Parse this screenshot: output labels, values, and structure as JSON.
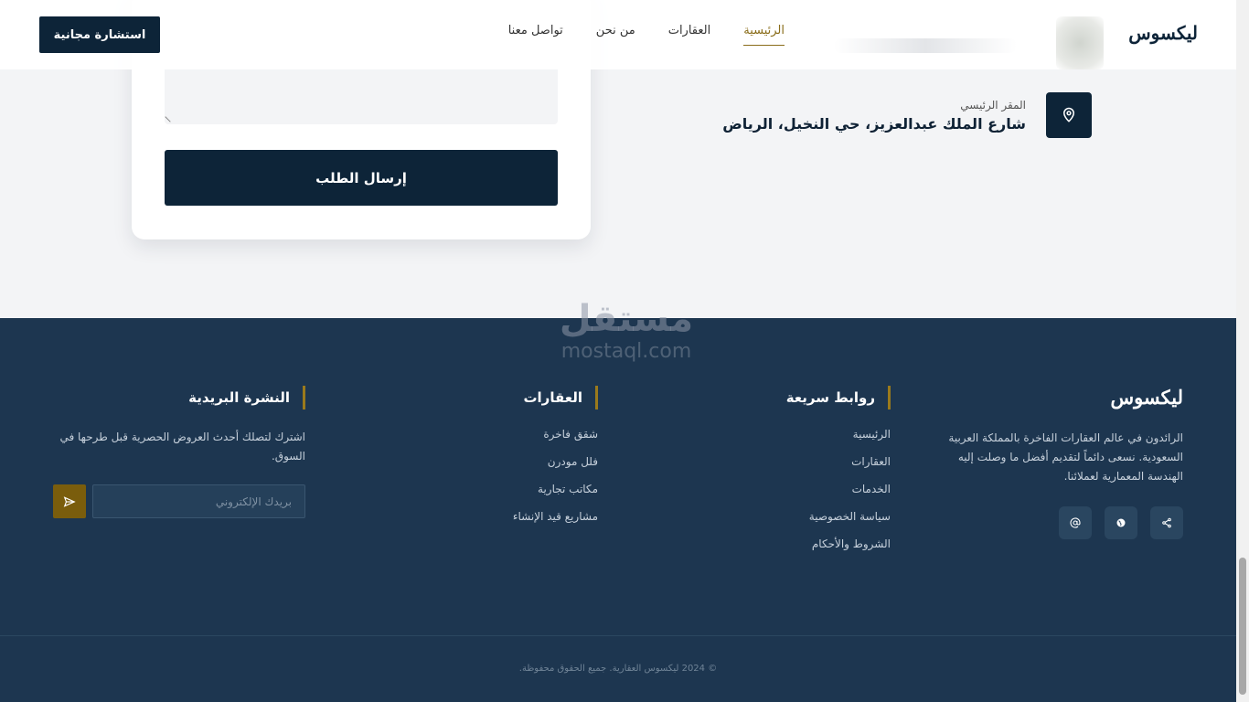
{
  "header": {
    "logo": "ليكسوس",
    "nav": [
      {
        "label": "الرئيسية",
        "active": true
      },
      {
        "label": "العقارات",
        "active": false
      },
      {
        "label": "من نحن",
        "active": false
      },
      {
        "label": "تواصل معنا",
        "active": false
      }
    ],
    "cta_label": "استشارة مجانية"
  },
  "contact": {
    "address_label": "المقر الرئيسي",
    "address_value": "شارع الملك عبدالعزيز، حي النخيل، الرياض",
    "submit_label": "إرسال الطلب"
  },
  "footer": {
    "brand": {
      "name": "ليكسوس",
      "description": "الرائدون في عالم العقارات الفاخرة بالمملكة العربية السعودية. نسعى دائماً لتقديم أفضل ما وصلت إليه الهندسة المعمارية لعملائنا."
    },
    "quick_links": {
      "title": "روابط سريعة",
      "items": [
        "الرئيسية",
        "العقارات",
        "الخدمات",
        "سياسة الخصوصية",
        "الشروط والأحكام"
      ]
    },
    "properties": {
      "title": "العقارات",
      "items": [
        "شقق فاخرة",
        "فلل مودرن",
        "مكاتب تجارية",
        "مشاريع قيد الإنشاء"
      ]
    },
    "newsletter": {
      "title": "النشرة البريدية",
      "description": "اشترك لتصلك أحدث العروض الحصرية قبل طرحها في السوق.",
      "email_placeholder": "بريدك الإلكتروني"
    },
    "copyright": "© 2024 ليكسوس العقارية. جميع الحقوق محفوظة."
  },
  "watermark": {
    "arabic": "مستقل",
    "latin": "mostaql.com"
  },
  "colors": {
    "navy": "#0d2438",
    "footer_bg": "#1d3650",
    "gold": "#8a6d1a"
  }
}
